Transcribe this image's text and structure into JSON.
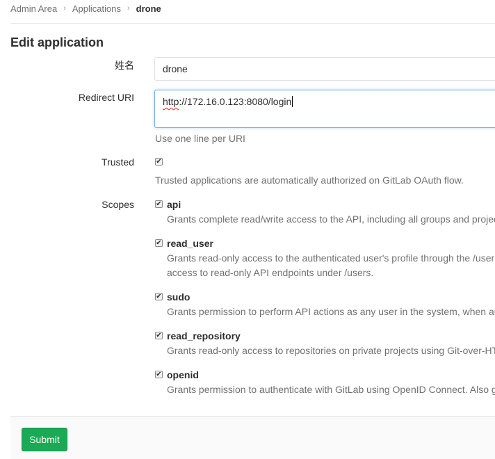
{
  "breadcrumb": {
    "items": [
      "Admin Area",
      "Applications"
    ],
    "current": "drone"
  },
  "page": {
    "title": "Edit application"
  },
  "form": {
    "name": {
      "label": "姓名",
      "value": "drone"
    },
    "redirect_uri": {
      "label": "Redirect URI",
      "value_prefix": "http",
      "value_rest": "://172.16.0.123:8080/login",
      "help": "Use one line per URI"
    },
    "trusted": {
      "label": "Trusted",
      "checked": true,
      "help": "Trusted applications are automatically authorized on GitLab OAuth flow."
    },
    "scopes": {
      "label": "Scopes",
      "items": [
        {
          "name": "api",
          "checked": true,
          "desc": [
            "Grants complete read/write access to the API, including all groups and projects"
          ]
        },
        {
          "name": "read_user",
          "checked": true,
          "desc": [
            "Grants read-only access to the authenticated user's profile through the /user",
            "access to read-only API endpoints under /users."
          ]
        },
        {
          "name": "sudo",
          "checked": true,
          "desc": [
            "Grants permission to perform API actions as any user in the system, when au"
          ]
        },
        {
          "name": "read_repository",
          "checked": true,
          "desc": [
            "Grants read-only access to repositories on private projects using Git-over-HT"
          ]
        },
        {
          "name": "openid",
          "checked": true,
          "desc": [
            "Grants permission to authenticate with GitLab using OpenID Connect. Also g"
          ]
        }
      ]
    }
  },
  "actions": {
    "submit_label": "Submit"
  },
  "colors": {
    "primary": "#1aaa55",
    "focus_border": "#73afea",
    "muted_text": "#707070"
  },
  "icons": {
    "breadcrumb_separator": "chevron-right-icon",
    "checkbox_mark": "checkmark-icon"
  }
}
